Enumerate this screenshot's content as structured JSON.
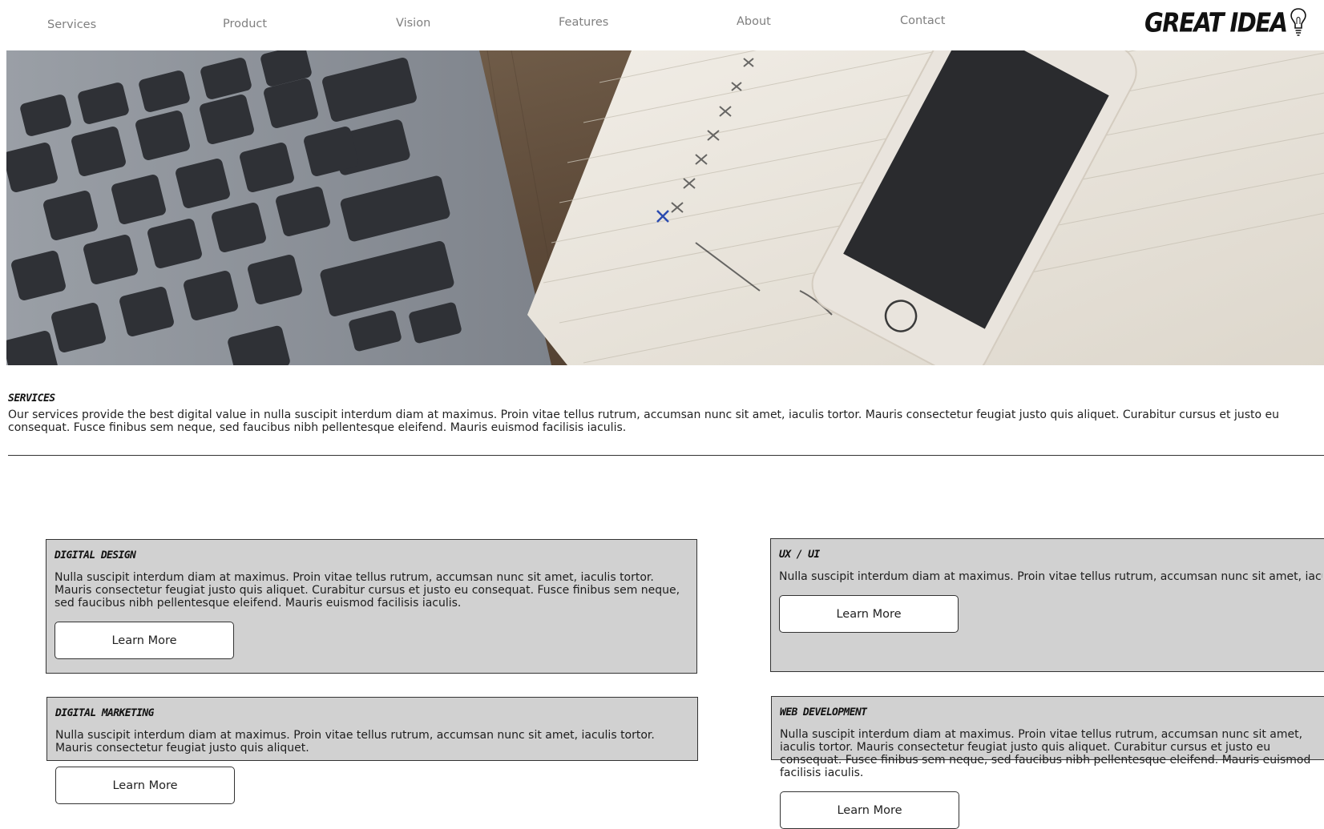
{
  "nav": {
    "links": [
      "Services",
      "Product",
      "Vision",
      "Features",
      "About",
      "Contact"
    ],
    "logo_text": "GREAT IDEA"
  },
  "hero": {
    "image_description_icon": "photo-laptop-notebook-phone-icon"
  },
  "services": {
    "title": "SERVICES",
    "description": "Our services provide the best digital value in nulla suscipit interdum diam at maximus. Proin vitae tellus rutrum, accumsan nunc sit amet, iaculis tortor. Mauris consectetur feugiat justo quis aliquet. Curabitur cursus et justo eu consequat. Fusce finibus sem neque, sed faucibus nibh pellentesque eleifend. Mauris euismod facilisis iaculis."
  },
  "cards": [
    {
      "title": "DIGITAL DESIGN",
      "text": "Nulla suscipit interdum diam at maximus. Proin vitae tellus rutrum, accumsan nunc sit amet, iaculis tortor. Mauris consectetur feugiat justo quis aliquet. Curabitur cursus et justo eu consequat. Fusce finibus sem neque, sed faucibus nibh pellentesque eleifend. Mauris euismod facilisis iaculis.",
      "button": "Learn More"
    },
    {
      "title": "UX / UI",
      "text": "Nulla suscipit interdum diam at maximus. Proin vitae tellus rutrum, accumsan nunc sit amet, iaculis tortor. Mauris consectetur feugiat justo quis aliquet. Curabitur cursus et justo eu consequat. Fusce finibus sem neque, sed faucibus nibh pellentesque eleifend. Mauris euismod facilisis iaculis.",
      "button": "Learn More"
    },
    {
      "title": "DIGITAL MARKETING",
      "text": "Nulla suscipit interdum diam at maximus. Proin vitae tellus rutrum, accumsan nunc sit amet, iaculis tortor. Mauris consectetur feugiat justo quis aliquet.",
      "button": "Learn More"
    },
    {
      "title": "WEB DEVELOPMENT",
      "text": "Nulla suscipit interdum diam at maximus. Proin vitae tellus rutrum, accumsan nunc sit amet, iaculis tortor. Mauris consectetur feugiat justo quis aliquet. Curabitur cursus et justo eu consequat. Fusce finibus sem neque, sed faucibus nibh pellentesque eleifend. Mauris euismod facilisis iaculis.",
      "button": "Learn More"
    }
  ]
}
